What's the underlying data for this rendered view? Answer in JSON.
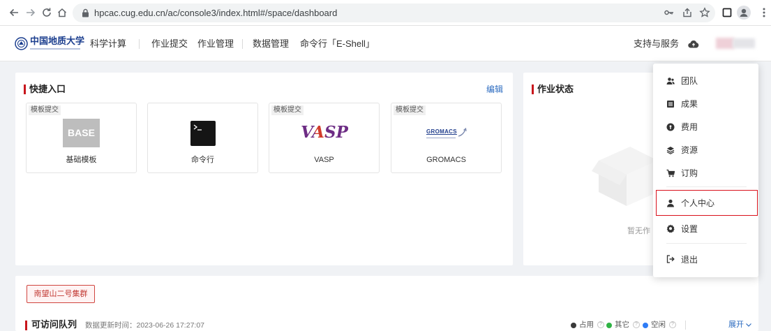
{
  "browser": {
    "url": "hpcac.cug.edu.cn/ac/console3/index.html#/space/dashboard"
  },
  "header": {
    "logo_text": "中国地质大学",
    "nav": [
      {
        "label": "科学计算"
      },
      {
        "label": "作业提交"
      },
      {
        "label": "作业管理"
      },
      {
        "label": "数据管理"
      },
      {
        "label": "命令行「E-Shell」"
      }
    ],
    "support_label": "支持与服务",
    "support_icon": "cloud-icon"
  },
  "quick_entry": {
    "title": "快捷入口",
    "edit_label": "编辑",
    "tiles": [
      {
        "tag": "模板提交",
        "logo_text": "BASE",
        "label": "基础模板"
      },
      {
        "tag": "",
        "logo_icon": "terminal-icon",
        "label": "命令行"
      },
      {
        "tag": "模板提交",
        "logo_text": "VASP",
        "label": "VASP"
      },
      {
        "tag": "模板提交",
        "logo_text": "GROMACS",
        "label": "GROMACS"
      }
    ]
  },
  "job_status": {
    "title": "作业状态",
    "empty_text": "暂无作"
  },
  "user_menu": {
    "items": [
      {
        "label": "团队",
        "icon": "team-icon"
      },
      {
        "label": "成果",
        "icon": "achievement-icon"
      },
      {
        "label": "费用",
        "icon": "fee-icon"
      },
      {
        "label": "资源",
        "icon": "resource-icon"
      },
      {
        "label": "订购",
        "icon": "cart-icon"
      },
      {
        "label": "个人中心",
        "icon": "user-icon",
        "highlighted": true
      },
      {
        "label": "设置",
        "icon": "settings-icon"
      },
      {
        "label": "退出",
        "icon": "logout-icon"
      }
    ]
  },
  "cluster": {
    "button_label": "南望山二号集群"
  },
  "queues": {
    "title": "可访问队列",
    "updated": "数据更新时间：2023-06-26 17:27:07",
    "legend": [
      {
        "label": "占用",
        "color": "#3a3a3a"
      },
      {
        "label": "其它",
        "color": "#2fb344"
      },
      {
        "label": "空闲",
        "color": "#2f7cf6"
      }
    ],
    "expand_label": "展开"
  },
  "theme": {
    "accent_red": "#c8161d",
    "link_blue": "#2d6cc0"
  }
}
